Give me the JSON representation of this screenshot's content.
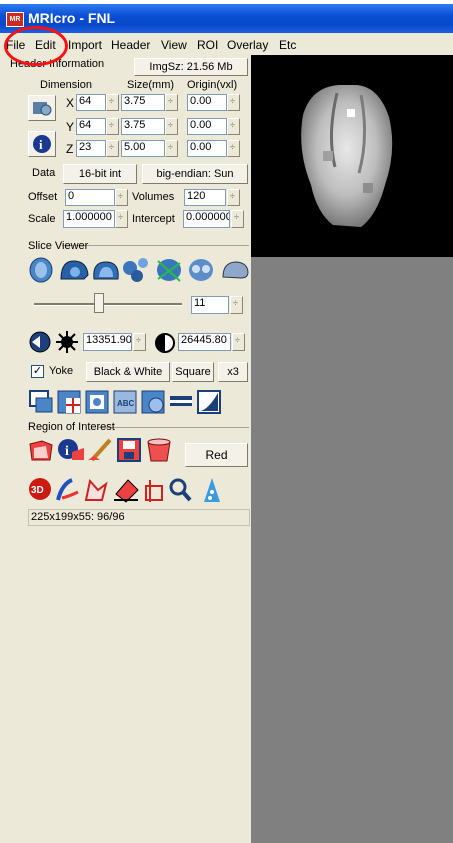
{
  "window": {
    "title": "MRIcro - FNL",
    "app_icon": "mricro-logo"
  },
  "menu": [
    "File",
    "Edit",
    "Import",
    "Header",
    "View",
    "ROI",
    "Overlay",
    "Etc"
  ],
  "header_info": {
    "group_label": "Header Information",
    "img_size_button": "ImgSz: 21.56 Mb",
    "col_dimension": "Dimension",
    "col_size": "Size(mm)",
    "col_origin": "Origin(vxl)",
    "rows": [
      {
        "axis": "X",
        "dim": "64",
        "size": "3.75",
        "origin": "0.00"
      },
      {
        "axis": "Y",
        "dim": "64",
        "size": "3.75",
        "origin": "0.00"
      },
      {
        "axis": "Z",
        "dim": "23",
        "size": "5.00",
        "origin": "0.00"
      }
    ],
    "data_label": "Data",
    "data_type_button": "16-bit int",
    "endian_button": "big-endian: Sun",
    "offset_label": "Offset",
    "offset_value": "0",
    "volumes_label": "Volumes",
    "volumes_value": "120",
    "scale_label": "Scale",
    "scale_value": "1.000000",
    "intercept_label": "Intercept",
    "intercept_value": "0.000000"
  },
  "slice_viewer": {
    "group_label": "Slice Viewer",
    "slice_value": "11",
    "min_value": "13351.90",
    "max_value": "26445.80",
    "yoke_label": "Yoke",
    "yoke_checked": true,
    "color_button": "Black & White",
    "shape_button": "Square",
    "zoom_button": "x3"
  },
  "roi": {
    "group_label": "Region of Interest",
    "color_button": "Red"
  },
  "status_text": "225x199x55: 96/96",
  "colors": {
    "panel": "#ece9d8",
    "titlebar": "#0a4fd6",
    "annotation": "#ff1010"
  }
}
